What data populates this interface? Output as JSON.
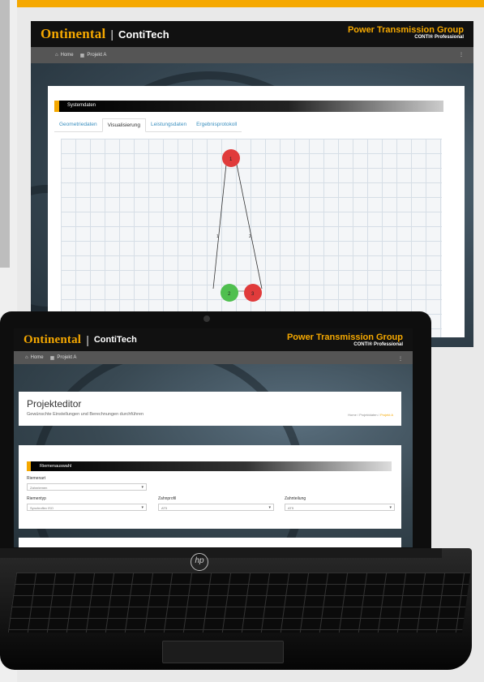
{
  "colors": {
    "accent": "#f5a800",
    "header": "#111111",
    "nav": "#555555",
    "link": "#3a8fbf"
  },
  "brand": {
    "logo": "Ontinental",
    "separator": "|",
    "product": "ContiTech",
    "group_title": "Power Transmission Group",
    "group_sub": "CONTI® Professional"
  },
  "nav": {
    "home": "Home",
    "project": "Projekt A"
  },
  "background_window": {
    "section_title": "Systemdaten",
    "tabs": [
      "Geometriedaten",
      "Visualisierung",
      "Leistungsdaten",
      "Ergebnisprotokoll"
    ],
    "active_tab": 1,
    "visualization": {
      "pulleys": [
        {
          "label": "1",
          "color": "#e03b3b"
        },
        {
          "label": "2",
          "color": "#4fbf4f"
        },
        {
          "label": "3",
          "color": "#e03b3b"
        }
      ],
      "belt_labels": [
        "1",
        "2"
      ]
    }
  },
  "laptop": {
    "editor": {
      "title": "Projekteditor",
      "subtitle": "Gewünschte Einstellungen und Berechnungen durchführen",
      "breadcrumb": [
        "Home",
        "Projektdaten",
        "Projekt A"
      ]
    },
    "belt_selection": {
      "section_title": "Riemenauswahl",
      "fields": [
        {
          "label": "Riemenart",
          "value": "Zahnriemen"
        },
        {
          "label": "Riementyp",
          "value": "Synchroflex ISO"
        },
        {
          "label": "Zahnprofil",
          "value": "AT5"
        },
        {
          "label": "Zahnteilung",
          "value": "AT5"
        }
      ]
    },
    "logo_mark": "hp"
  }
}
